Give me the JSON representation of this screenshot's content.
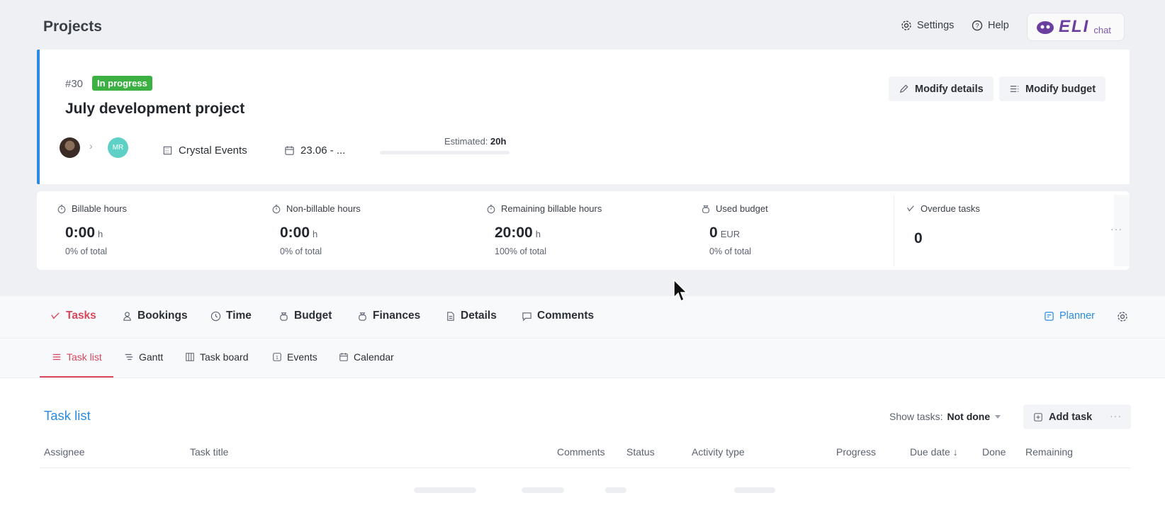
{
  "header": {
    "title": "Projects",
    "settings_label": "Settings",
    "help_label": "Help",
    "eli_logo": "ELI",
    "eli_chat": "chat"
  },
  "project": {
    "number": "#30",
    "status": "In progress",
    "title": "July development project",
    "modify_details_label": "Modify details",
    "modify_budget_label": "Modify budget",
    "assignee_initials": "MR",
    "client": "Crystal Events",
    "date_range": "23.06 - ...",
    "estimated_label": "Estimated:",
    "estimated_value": "20h",
    "progress": 0
  },
  "stats": [
    {
      "label": "Billable hours",
      "value": "0:00",
      "unit": "h",
      "sub": "0% of total"
    },
    {
      "label": "Non-billable hours",
      "value": "0:00",
      "unit": "h",
      "sub": "0% of total"
    },
    {
      "label": "Remaining billable hours",
      "value": "20:00",
      "unit": "h",
      "sub": "100% of total"
    },
    {
      "label": "Used budget",
      "value": "0",
      "unit": "EUR",
      "sub": "0% of total"
    },
    {
      "label": "Overdue tasks",
      "value": "0"
    }
  ],
  "tabs": [
    "Tasks",
    "Bookings",
    "Time",
    "Budget",
    "Finances",
    "Details",
    "Comments"
  ],
  "planner_label": "Planner",
  "subtabs": [
    "Task list",
    "Gantt",
    "Task board",
    "Events",
    "Calendar"
  ],
  "task_list": {
    "title": "Task list",
    "show_tasks_label": "Show tasks:",
    "show_tasks_value": "Not done",
    "add_task_label": "Add task",
    "columns": [
      "Assignee",
      "Task title",
      "Comments",
      "Status",
      "Activity type",
      "Progress",
      "Due date ↓",
      "Done",
      "Remaining"
    ]
  },
  "colors": {
    "accent_blue": "#2b8be0",
    "active_red": "#d9465b",
    "status_green": "#3cb043"
  }
}
